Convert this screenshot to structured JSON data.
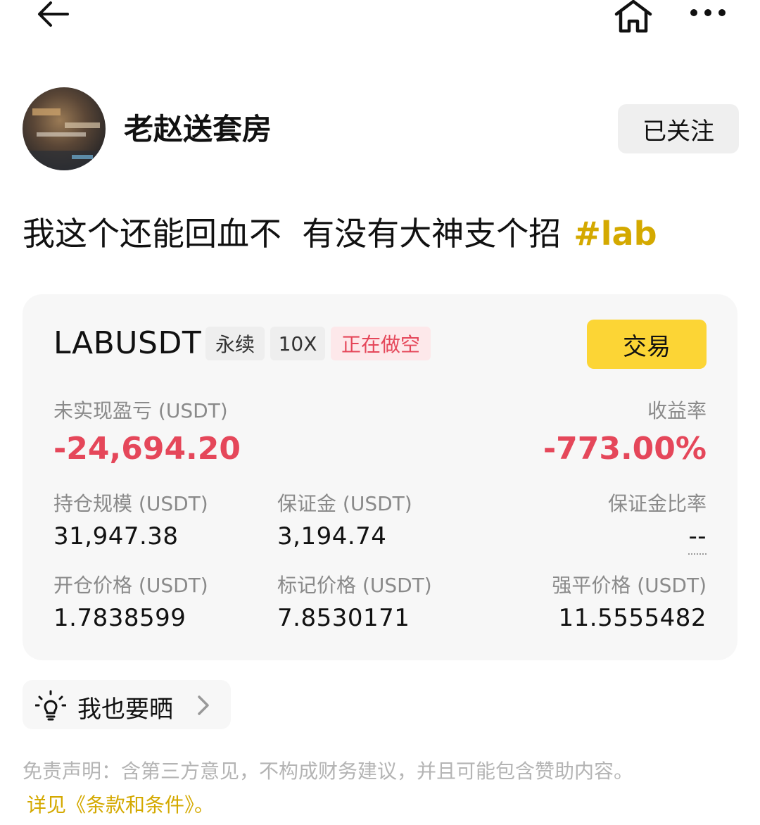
{
  "author": {
    "name": "老赵送套房",
    "follow_label": "已关注"
  },
  "post": {
    "text": "我这个还能回血不  有没有大神支个招",
    "hashtag": "#lab"
  },
  "position": {
    "symbol": "LABUSDT",
    "tag_type": "永续",
    "tag_leverage": "10X",
    "tag_status": "正在做空",
    "trade_label": "交易",
    "unrealized_pnl_label": "未实现盈亏 (USDT)",
    "unrealized_pnl_value": "-24,694.20",
    "roi_label": "收益率",
    "roi_value": "-773.00%",
    "size_label": "持仓规模 (USDT)",
    "size_value": "31,947.38",
    "margin_label": "保证金 (USDT)",
    "margin_value": "3,194.74",
    "margin_ratio_label": "保证金比率",
    "margin_ratio_value": "--",
    "entry_label": "开仓价格 (USDT)",
    "entry_value": "1.7838599",
    "mark_label": "标记价格 (USDT)",
    "mark_value": "7.8530171",
    "liq_label": "强平价格 (USDT)",
    "liq_value": "11.5555482"
  },
  "share": {
    "label": "我也要晒"
  },
  "disclaimer": {
    "text": "免责声明：含第三方意见，不构成财务建议，并且可能包含赞助内容。",
    "terms_text": "详见《条款和条件》",
    "terms_suffix": "。"
  },
  "colors": {
    "accent_yellow": "#fcd535",
    "hashtag_gold": "#d4a900",
    "loss_red": "#e5475a"
  },
  "icons": {
    "back": "back-arrow-icon",
    "home": "home-icon",
    "more": "more-icon",
    "share": "lightbulb-icon",
    "chevron": "chevron-right-icon"
  }
}
